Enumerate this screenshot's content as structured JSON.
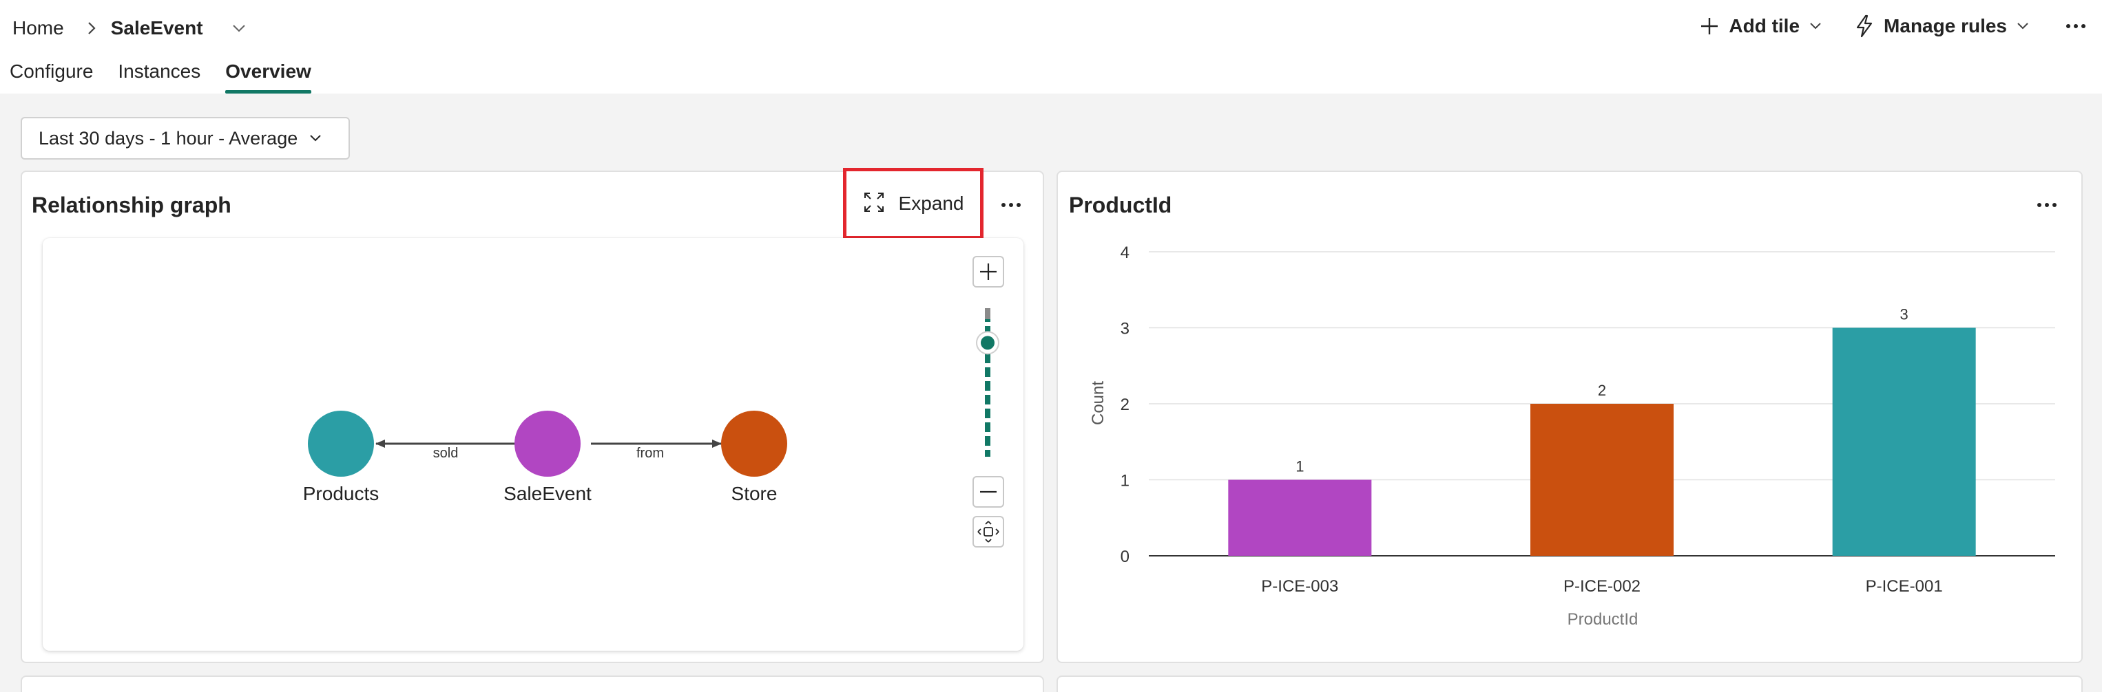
{
  "breadcrumb": {
    "home": "Home",
    "current": "SaleEvent"
  },
  "tabs": [
    {
      "label": "Configure",
      "active": false
    },
    {
      "label": "Instances",
      "active": false
    },
    {
      "label": "Overview",
      "active": true
    }
  ],
  "header_actions": {
    "add_tile": "Add tile",
    "manage_rules": "Manage rules"
  },
  "filter": {
    "label": "Last 30 days - 1 hour - Average"
  },
  "relationship_card": {
    "title": "Relationship graph",
    "expand_label": "Expand",
    "nodes": [
      {
        "label": "Products",
        "color": "#2b9ea5"
      },
      {
        "label": "SaleEvent",
        "color": "#b146c2"
      },
      {
        "label": "Store",
        "color": "#ca500f"
      }
    ],
    "edges": [
      {
        "label": "sold"
      },
      {
        "label": "from"
      }
    ],
    "zoom_level": 0.82
  },
  "product_card": {
    "title": "ProductId"
  },
  "chart_data": {
    "type": "bar",
    "categories": [
      "P-ICE-003",
      "P-ICE-002",
      "P-ICE-001"
    ],
    "values": [
      1,
      2,
      3
    ],
    "colors": [
      "#b146c2",
      "#ca500f",
      "#2b9ea5"
    ],
    "data_labels": [
      "1",
      "2",
      "3"
    ],
    "xlabel": "ProductId",
    "ylabel": "Count",
    "ylim": [
      0,
      4
    ],
    "yticks": [
      "0",
      "1",
      "2",
      "3",
      "4"
    ],
    "grid": true
  },
  "colors": {
    "accent": "#117865",
    "highlight": "#e3262e"
  }
}
